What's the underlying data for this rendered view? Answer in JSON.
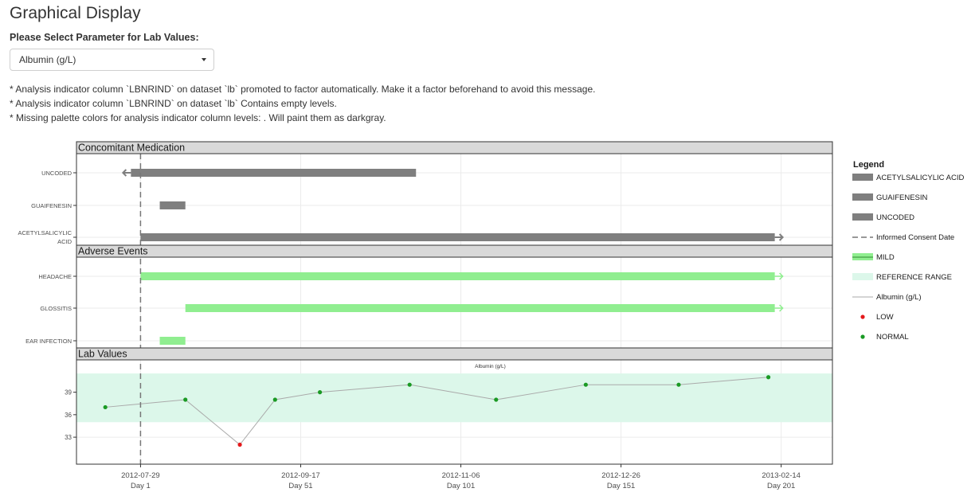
{
  "page": {
    "title": "Graphical Display",
    "select_label": "Please Select Parameter for Lab Values:",
    "select_value": "Albumin (g/L)",
    "messages": [
      "* Analysis indicator column `LBNRIND` on dataset `lb` promoted to factor automatically. Make it a factor beforehand to avoid this message.",
      "* Analysis indicator column `LBNRIND` on dataset `lb` Contains empty levels.",
      "* Missing palette colors for analysis indicator column levels: . Will paint them as darkgray."
    ]
  },
  "chart_data": {
    "type": "timeline",
    "x_axis": {
      "ticks": [
        {
          "day": 1,
          "date": "2012-07-29",
          "label": "Day 1"
        },
        {
          "day": 51,
          "date": "2012-09-17",
          "label": "Day 51"
        },
        {
          "day": 101,
          "date": "2012-11-06",
          "label": "Day 101"
        },
        {
          "day": 151,
          "date": "2012-12-26",
          "label": "Day 151"
        },
        {
          "day": 201,
          "date": "2013-02-14",
          "label": "Day 201"
        }
      ],
      "range_days": [
        -19,
        217
      ]
    },
    "informed_consent_day": 1,
    "panels": {
      "conmed": {
        "title": "Concomitant Medication",
        "color": "#7f7f7f",
        "rows": [
          {
            "label": "UNCODED",
            "start": -2,
            "end": 87,
            "start_arrow": true,
            "end_arrow": false
          },
          {
            "label": "GUAIFENESIN",
            "start": 7,
            "end": 15,
            "start_arrow": false,
            "end_arrow": false
          },
          {
            "label": "ACETYLSALICYLIC ACID",
            "start": 1,
            "end": 199,
            "start_arrow": false,
            "end_arrow": true
          }
        ]
      },
      "ae": {
        "title": "Adverse Events",
        "color": "#90ee90",
        "rows": [
          {
            "label": "HEADACHE",
            "start": 1,
            "end": 199,
            "end_arrow": true
          },
          {
            "label": "GLOSSITIS",
            "start": 15,
            "end": 199,
            "end_arrow": true
          },
          {
            "label": "EAR INFECTION",
            "start": 7,
            "end": 15,
            "end_arrow": false
          }
        ]
      },
      "lab": {
        "title": "Lab Values",
        "subtitle": "Albumin (g/L)",
        "ylim": [
          29.4,
          43.1
        ],
        "yticks": [
          33,
          36,
          39
        ],
        "reference_range": [
          35,
          41.5
        ],
        "reference_color": "#dcf7ea",
        "line_color": "#aaaaaa",
        "points": [
          {
            "day": -10,
            "value": 37,
            "flag": "NORMAL"
          },
          {
            "day": 15,
            "value": 38,
            "flag": "NORMAL"
          },
          {
            "day": 32,
            "value": 32,
            "flag": "LOW"
          },
          {
            "day": 43,
            "value": 38,
            "flag": "NORMAL"
          },
          {
            "day": 57,
            "value": 39,
            "flag": "NORMAL"
          },
          {
            "day": 85,
            "value": 40,
            "flag": "NORMAL"
          },
          {
            "day": 112,
            "value": 38,
            "flag": "NORMAL"
          },
          {
            "day": 140,
            "value": 40,
            "flag": "NORMAL"
          },
          {
            "day": 169,
            "value": 40,
            "flag": "NORMAL"
          },
          {
            "day": 197,
            "value": 41,
            "flag": "NORMAL"
          }
        ]
      }
    },
    "flag_colors": {
      "LOW": "#e41a1c",
      "NORMAL": "#1a9a24"
    },
    "legend": {
      "title": "Legend",
      "position": "right",
      "items": [
        {
          "label": "ACETYLSALICYLIC ACID",
          "kind": "bar",
          "color": "#7f7f7f"
        },
        {
          "label": "GUAIFENESIN",
          "kind": "bar",
          "color": "#7f7f7f"
        },
        {
          "label": "UNCODED",
          "kind": "bar",
          "color": "#7f7f7f"
        },
        {
          "label": "Informed Consent Date",
          "kind": "dash",
          "color": "#777777"
        },
        {
          "label": "MILD",
          "kind": "bar-line",
          "color": "#90ee90"
        },
        {
          "label": "REFERENCE RANGE",
          "kind": "bar",
          "color": "#dcf7ea"
        },
        {
          "label": "Albumin (g/L)",
          "kind": "line",
          "color": "#aaaaaa"
        },
        {
          "label": "LOW",
          "kind": "point",
          "color": "#e41a1c"
        },
        {
          "label": "NORMAL",
          "kind": "point",
          "color": "#1a9a24"
        }
      ]
    }
  }
}
